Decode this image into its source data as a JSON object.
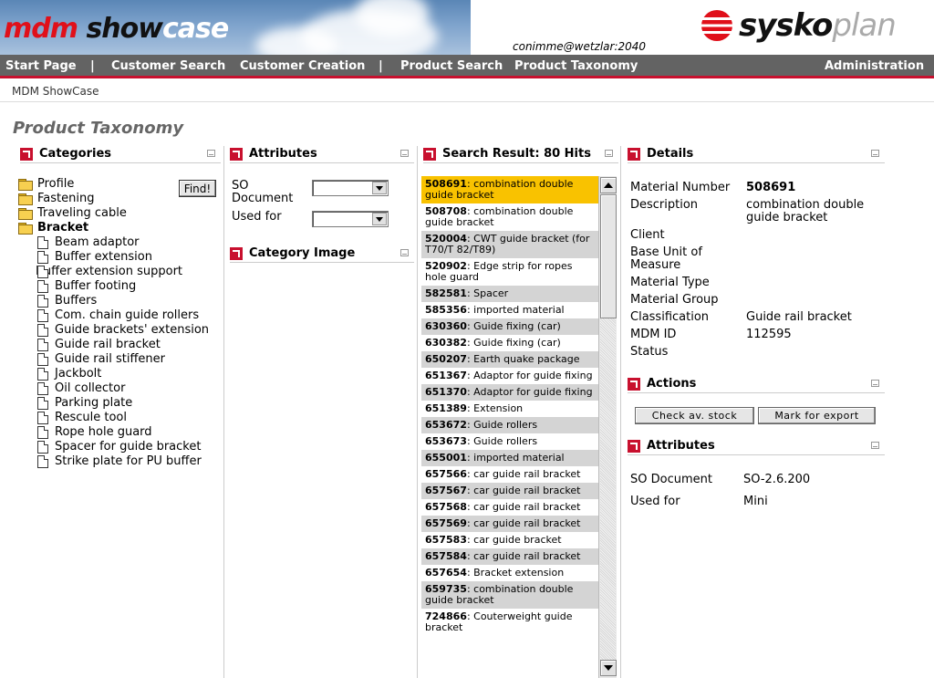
{
  "header": {
    "logo_part1": "mdm",
    "logo_part2": " show",
    "logo_part3": "case",
    "user": "conimme@wetzlar:2040",
    "brand_part1": "sysko",
    "brand_part2": "plan"
  },
  "nav": {
    "start": "Start Page",
    "sep": "|",
    "customer_search": "Customer Search",
    "customer_creation": "Customer Creation",
    "product_search": "Product Search",
    "product_taxonomy": "Product Taxonomy",
    "administration": "Administration"
  },
  "breadcrumb": "MDM ShowCase",
  "page_title": "Product Taxonomy",
  "categories": {
    "title": "Categories",
    "find_label": "Find!",
    "folders": [
      "Profile",
      "Fastening",
      "Traveling cable"
    ],
    "open_folder": "Bracket",
    "items": [
      "Beam adaptor",
      "Buffer extension",
      "Buffer extension support",
      "Buffer footing",
      "Buffers",
      "Com. chain guide rollers",
      "Guide brackets' extension",
      "Guide rail bracket",
      "Guide rail stiffener",
      "Jackbolt",
      "Oil collector",
      "Parking plate",
      "Rescule tool",
      "Rope hole guard",
      "Spacer for guide bracket",
      "Strike plate for PU buffer"
    ]
  },
  "attributes_left": {
    "title": "Attributes",
    "so_document_label": "SO Document",
    "used_for_label": "Used for"
  },
  "category_image": {
    "title": "Category Image"
  },
  "search_result": {
    "title": "Search Result: 80 Hits",
    "rows": [
      {
        "id": "508691",
        "text": ": combination double guide bracket"
      },
      {
        "id": "508708",
        "text": ": combination double guide bracket"
      },
      {
        "id": "520004",
        "text": ": CWT guide bracket (for T70/T 82/T89)"
      },
      {
        "id": "520902",
        "text": ": Edge strip for ropes hole guard"
      },
      {
        "id": "582581",
        "text": ": Spacer"
      },
      {
        "id": "585356",
        "text": ": imported material"
      },
      {
        "id": "630360",
        "text": ": Guide fixing (car)"
      },
      {
        "id": "630382",
        "text": ": Guide fixing (car)"
      },
      {
        "id": "650207",
        "text": ": Earth quake package"
      },
      {
        "id": "651367",
        "text": ": Adaptor for guide fixing"
      },
      {
        "id": "651370",
        "text": ": Adaptor for guide fixing"
      },
      {
        "id": "651389",
        "text": ": Extension"
      },
      {
        "id": "653672",
        "text": ": Guide rollers"
      },
      {
        "id": "653673",
        "text": ": Guide rollers"
      },
      {
        "id": "655001",
        "text": ": imported material"
      },
      {
        "id": "657566",
        "text": ": car guide rail bracket"
      },
      {
        "id": "657567",
        "text": ": car guide rail bracket"
      },
      {
        "id": "657568",
        "text": ": car guide rail bracket"
      },
      {
        "id": "657569",
        "text": ": car guide rail bracket"
      },
      {
        "id": "657583",
        "text": ": car guide bracket"
      },
      {
        "id": "657584",
        "text": ": car guide rail bracket"
      },
      {
        "id": "657654",
        "text": ": Bracket extension"
      },
      {
        "id": "659735",
        "text": ": combination double guide bracket"
      },
      {
        "id": "724866",
        "text": ": Couterweight guide bracket"
      }
    ]
  },
  "details": {
    "title": "Details",
    "material_number_label": "Material Number",
    "material_number": "508691",
    "description_label": "Description",
    "description": "combination double guide bracket",
    "client_label": "Client",
    "base_unit_label": "Base Unit of Measure",
    "material_type_label": "Material Type",
    "material_group_label": "Material Group",
    "classification_label": "Classification",
    "classification": "Guide rail bracket",
    "mdm_id_label": "MDM ID",
    "mdm_id": "112595",
    "status_label": "Status"
  },
  "actions": {
    "title": "Actions",
    "check_stock": "Check av. stock",
    "mark_export": "Mark for export"
  },
  "attributes_right": {
    "title": "Attributes",
    "so_document_label": "SO Document",
    "so_document": "SO-2.6.200",
    "used_for_label": "Used for",
    "used_for": "Mini"
  },
  "colors": {
    "accent_red": "#c8102e",
    "nav_gray": "#636363",
    "selected_row": "#f9c200",
    "alt_row": "#d4d4d4"
  }
}
